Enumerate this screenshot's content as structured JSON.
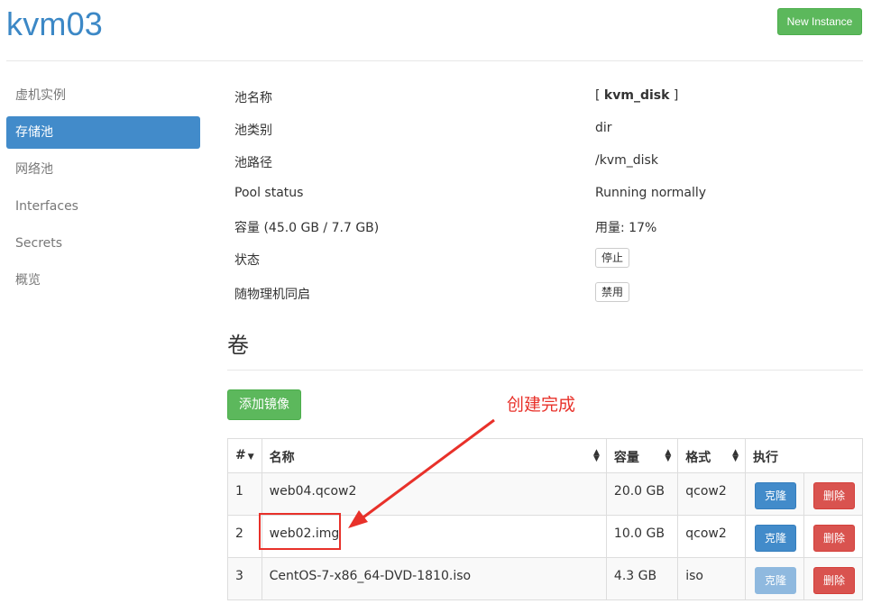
{
  "header": {
    "title": "kvm03",
    "new_instance_label": "New Instance"
  },
  "sidebar": {
    "items": [
      {
        "label": "虚机实例",
        "active": false
      },
      {
        "label": "存储池",
        "active": true
      },
      {
        "label": "网络池",
        "active": false
      },
      {
        "label": "Interfaces",
        "active": false
      },
      {
        "label": "Secrets",
        "active": false
      },
      {
        "label": "概览",
        "active": false
      }
    ]
  },
  "pool": {
    "name_label": "池名称",
    "name_prefix": "[ ",
    "name_value": "kvm_disk",
    "name_suffix": " ]",
    "type_label": "池类别",
    "type_value": "dir",
    "path_label": "池路径",
    "path_value": "/kvm_disk",
    "status_label": "Pool status",
    "status_value": "Running normally",
    "capacity_label": "容量 (45.0 GB / 7.7 GB)",
    "usage_value": "用量: 17%",
    "state_label": "状态",
    "stop_button": "停止",
    "autostart_label": "随物理机同启",
    "disable_button": "禁用"
  },
  "volumes": {
    "section_title": "卷",
    "add_button": "添加镜像",
    "columns": {
      "num": "#",
      "name": "名称",
      "size": "容量",
      "format": "格式",
      "actions": "执行"
    },
    "clone_label": "克隆",
    "delete_label": "删除",
    "rows": [
      {
        "num": "1",
        "name": "web04.qcow2",
        "size": "20.0 GB",
        "format": "qcow2"
      },
      {
        "num": "2",
        "name": "web02.img",
        "size": "10.0 GB",
        "format": "qcow2"
      },
      {
        "num": "3",
        "name": "CentOS-7-x86_64-DVD-1810.iso",
        "size": "4.3 GB",
        "format": "iso"
      }
    ]
  },
  "annotation": {
    "text": "创建完成",
    "color": "#e8312a"
  },
  "colors": {
    "brand_blue": "#3c88c6",
    "active_blue": "#428bca",
    "success_green": "#5cb85c",
    "danger_red": "#d9534f"
  },
  "icons": {
    "sort": "sort-both-icon",
    "caret": "caret-down-icon"
  }
}
